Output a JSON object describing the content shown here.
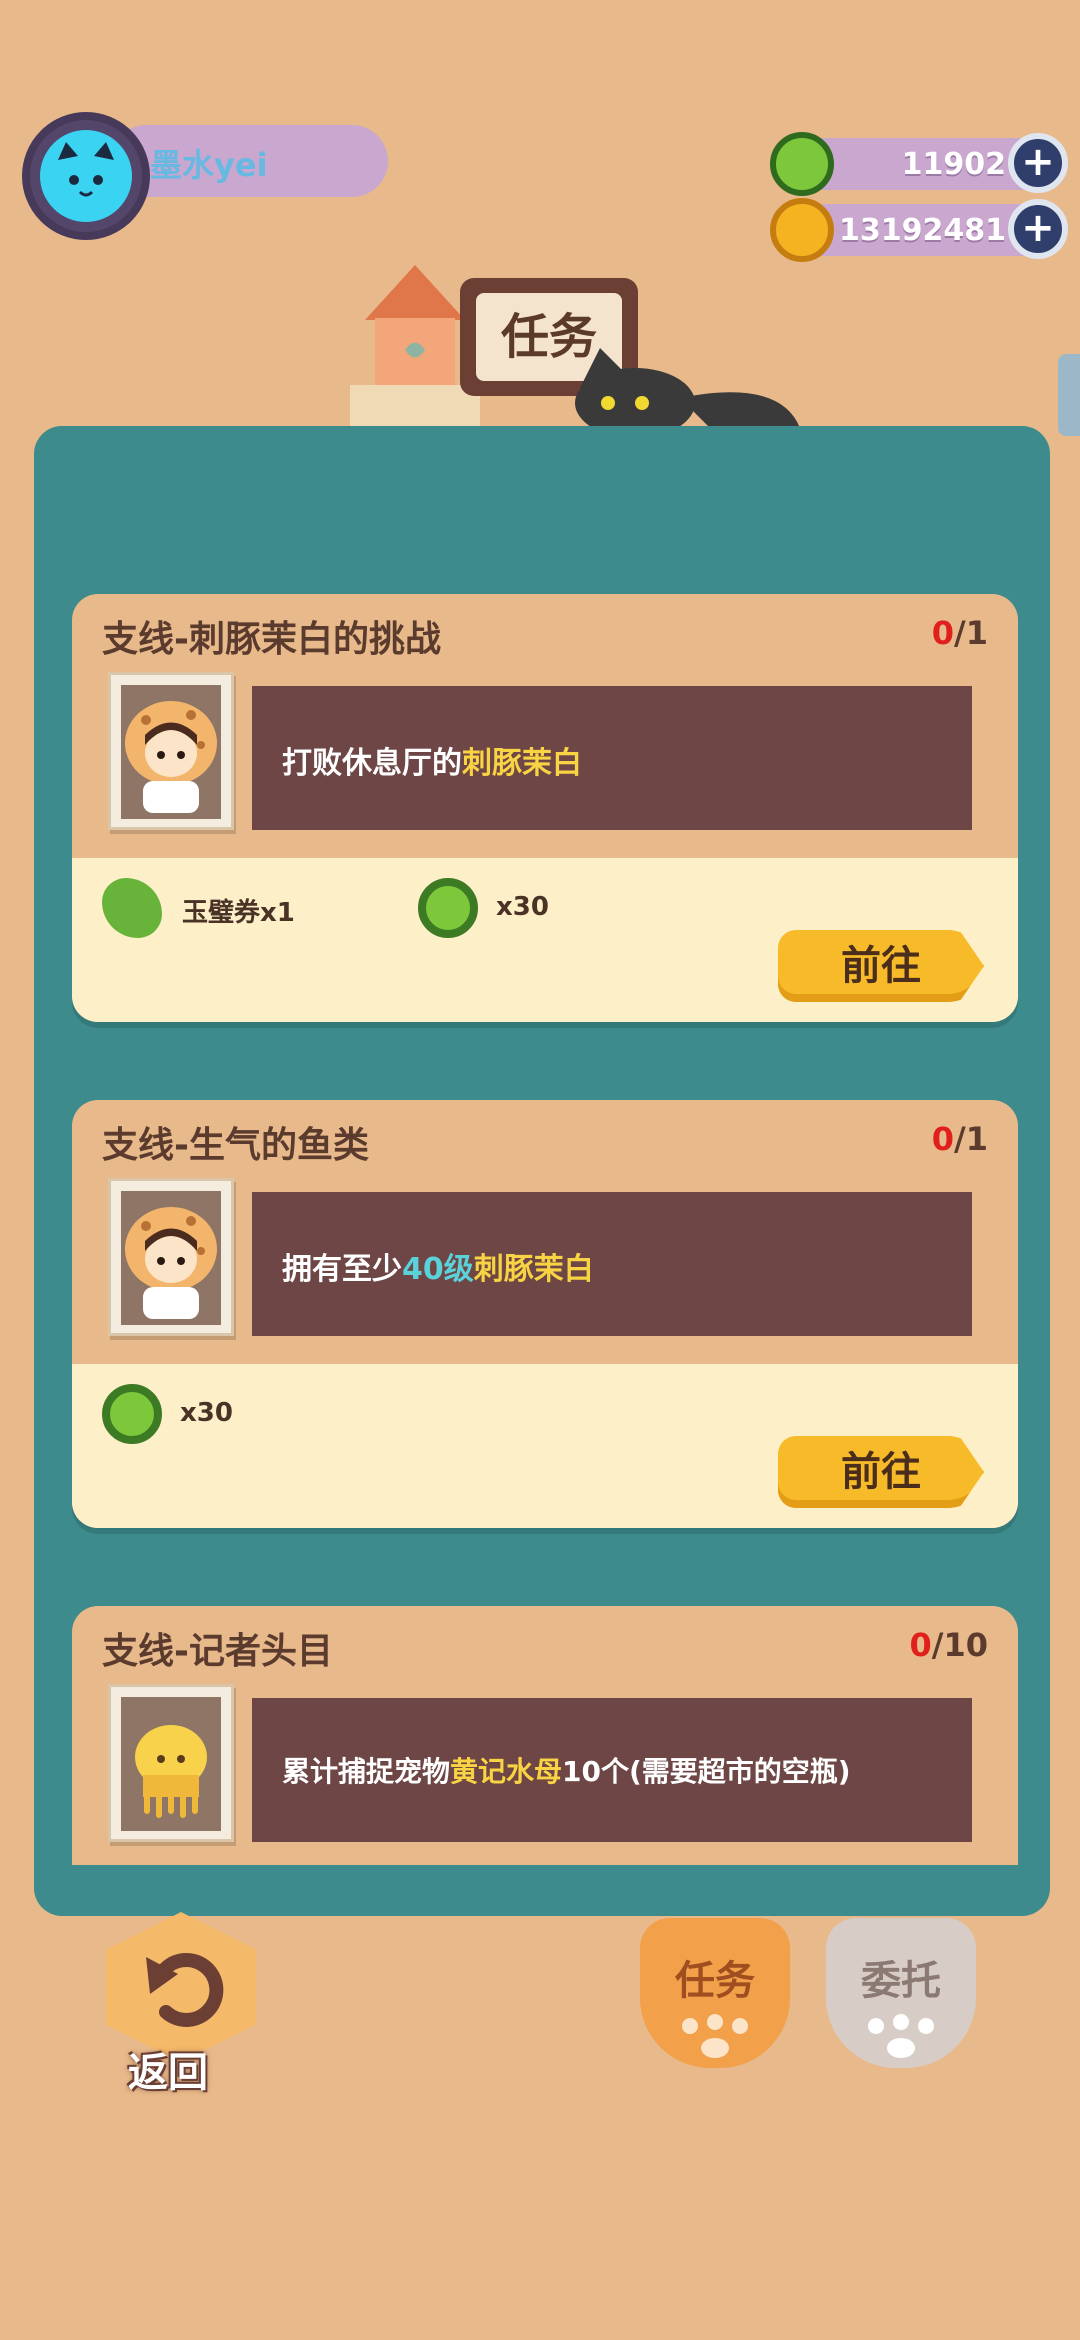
{
  "player": {
    "name": "墨水yei"
  },
  "currencies": [
    {
      "icon": "jade-coin-icon",
      "value": "11902",
      "color": "#7cc83a"
    },
    {
      "icon": "gold-coin-icon",
      "value": "13192481",
      "color": "#f5b321"
    }
  ],
  "header": {
    "title": "任务"
  },
  "quests": [
    {
      "title": "支线-刺豚茉白的挑战",
      "progress_current": "0",
      "progress_total": "/1",
      "desc_parts": [
        "打败休息厅的",
        "刺豚茉白",
        ""
      ],
      "rewards": [
        {
          "icon": "jade-ticket-icon",
          "label": "玉璧券x1"
        },
        {
          "icon": "jade-coin-icon",
          "label": "x30"
        }
      ],
      "button": "前往"
    },
    {
      "title": "支线-生气的鱼类",
      "progress_current": "0",
      "progress_total": "/1",
      "desc_parts": [
        "拥有至少",
        "40级",
        "刺豚茉白"
      ],
      "rewards": [
        {
          "icon": "jade-coin-icon",
          "label": "x30"
        }
      ],
      "button": "前往"
    },
    {
      "title": "支线-记者头目",
      "progress_current": "0",
      "progress_total": "/10",
      "desc_parts": [
        "累计捕捉宠物",
        "黄记水母",
        "10个(需要超市的空瓶)"
      ]
    }
  ],
  "footer": {
    "back_label": "返回",
    "tabs": [
      {
        "label": "任务",
        "active": true
      },
      {
        "label": "委托",
        "active": false
      }
    ]
  }
}
